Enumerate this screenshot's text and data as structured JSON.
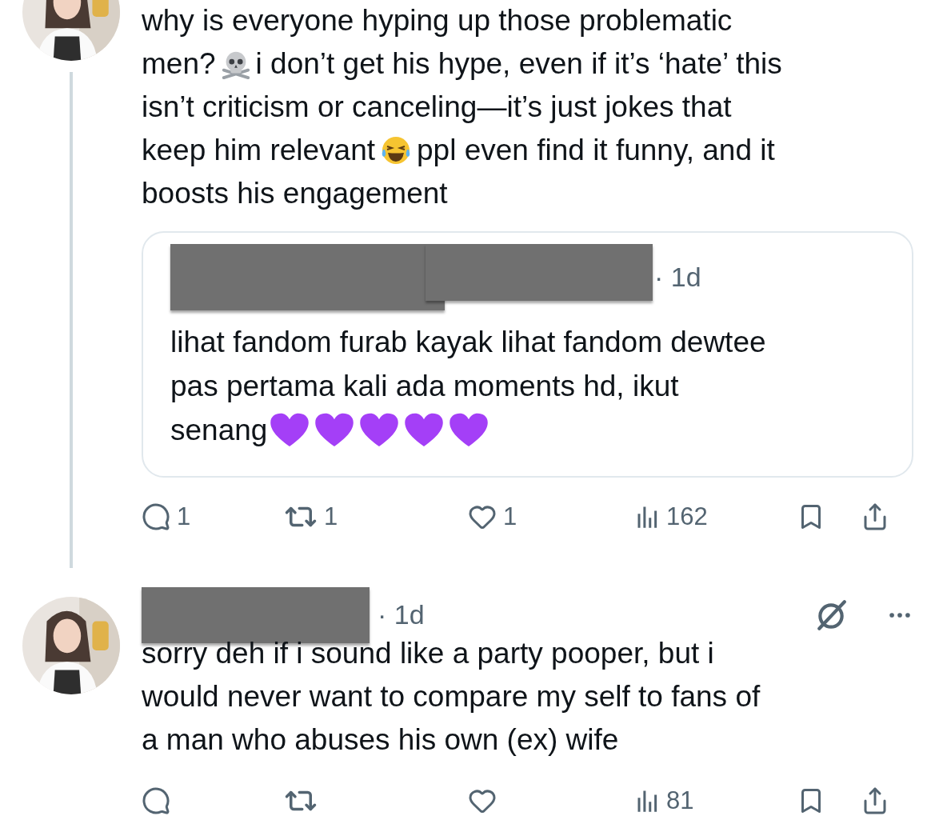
{
  "tweets": [
    {
      "thread_line": true,
      "lines": [
        [
          {
            "kind": "text",
            "text": "why is everyone hyping up those problematic"
          }
        ],
        [
          {
            "kind": "text",
            "text": "men?"
          },
          {
            "kind": "skull-emoji"
          },
          {
            "kind": "text",
            "text": "i don’t get his hype, even if it’s ‘hate’ this"
          }
        ],
        [
          {
            "kind": "text",
            "text": "isn’t criticism or canceling—it’s just jokes that"
          }
        ],
        [
          {
            "kind": "text",
            "text": "keep him relevant"
          },
          {
            "kind": "laughing-emoji"
          },
          {
            "kind": "text",
            "text": "ppl even find it funny, and it"
          }
        ],
        [
          {
            "kind": "text",
            "text": "boosts his engagement"
          }
        ]
      ],
      "quote": {
        "time": "· 1d",
        "lines": [
          [
            {
              "kind": "text",
              "text": "lihat fandom furab kayak lihat fandom dewtee"
            }
          ],
          [
            {
              "kind": "text",
              "text": "pas pertama kali ada moments hd, ikut"
            }
          ],
          [
            {
              "kind": "text",
              "text": "senang"
            },
            {
              "kind": "heart-emoji"
            },
            {
              "kind": "heart-emoji"
            },
            {
              "kind": "heart-emoji"
            },
            {
              "kind": "heart-emoji"
            },
            {
              "kind": "heart-emoji"
            }
          ]
        ]
      },
      "actions": {
        "replies": "1",
        "reposts": "1",
        "likes": "1",
        "views": "162"
      }
    },
    {
      "thread_line": false,
      "time": "· 1d",
      "lines": [
        [
          {
            "kind": "text",
            "text": "sorry deh if i sound like a party pooper, but i"
          }
        ],
        [
          {
            "kind": "text",
            "text": "would never want to compare my self to fans of"
          }
        ],
        [
          {
            "kind": "text",
            "text": "a man who abuses his own (ex) wife"
          }
        ]
      ],
      "actions": {
        "views": "81"
      }
    }
  ]
}
